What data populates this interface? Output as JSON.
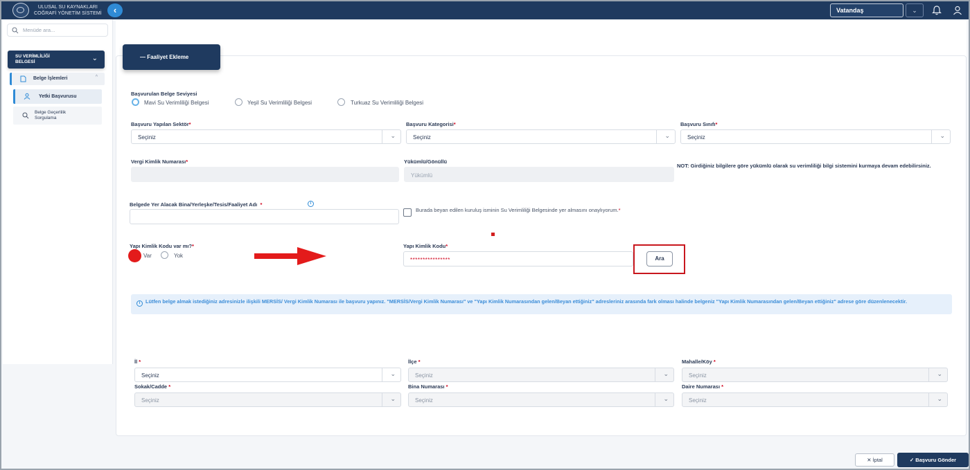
{
  "app": {
    "title_line1": "ULUSAL SU KAYNAKLARI",
    "title_line2": "COĞRAFİ YÖNETİM SİSTEMİ",
    "role": "Vatandaş"
  },
  "sidebar": {
    "search_placeholder": "Menüde ara...",
    "section": "SU VERİMLİLİĞİ BELGESİ",
    "group": "Belge İşlemleri",
    "items": [
      {
        "label": "Yetki Başvurusu"
      },
      {
        "label": "Belge Geçerlilik Sorgulama"
      }
    ]
  },
  "tab": {
    "label": "— Faaliyet Ekleme"
  },
  "form": {
    "seviye": {
      "label": "Başvurulan Belge Seviyesi",
      "options": [
        "Mavi Su Verimliliği Belgesi",
        "Yeşil Su Verimliliği Belgesi",
        "Turkuaz Su Verimliliği Belgesi"
      ],
      "selected": "Mavi Su Verimliliği Belgesi"
    },
    "sektor": {
      "label": "Başvuru Yapılan Sektör",
      "value": "Seçiniz"
    },
    "kategori": {
      "label": "Başvuru Kategorisi",
      "value": "Seçiniz"
    },
    "sinif": {
      "label": "Başvuru Sınıfı",
      "value": "Seçiniz"
    },
    "vkn": {
      "label": "Vergi Kimlik Numarası",
      "value": ""
    },
    "yukumlu": {
      "label": "Yükümlü/Gönüllü",
      "value": "Yükümlü"
    },
    "note": "NOT: Girdiğiniz bilgilere göre yükümlü olarak su verimliliği bilgi sistemini kurmaya devam edebilirsiniz.",
    "bina_adi": {
      "label": "Belgede Yer Alacak Bina/Yerleşke/Tesis/Faaliyet Adı",
      "value": ""
    },
    "onay_text": "Burada beyan edilen kuruluş isminin Su Verimliliği Belgesinde yer almasını onaylıyorum.",
    "yapi_var_mi": {
      "label": "Yapı Kimlik Kodu var mı?",
      "options": [
        "Var",
        "Yok"
      ],
      "selected": "Var"
    },
    "yapi_kod": {
      "label": "Yapı Kimlik Kodu",
      "value": "****************"
    },
    "ara_label": "Ara",
    "info": "Lütfen belge almak istediğiniz adresinizle ilişkili MERSİS/ Vergi Kimlik Numarası ile başvuru yapınız. \"MERSİS/Vergi Kimlik Numarası\" ve \"Yapı Kimlik Numarasından gelen/Beyan ettiğiniz\" adresleriniz arasında fark olması halinde belgeniz \"Yapı Kimlik Numarasından gelen/Beyan ettiğiniz\" adrese göre düzenlenecektir.",
    "address": {
      "il": {
        "label": "İl",
        "value": "Seçiniz"
      },
      "ilce": {
        "label": "İlçe",
        "value": "Seçiniz"
      },
      "mahalle": {
        "label": "Mahalle/Köy",
        "value": "Seçiniz"
      },
      "sokak": {
        "label": "Sokak/Cadde",
        "value": "Seçiniz"
      },
      "bina_no": {
        "label": "Bina Numarası",
        "value": "Seçiniz"
      },
      "daire_no": {
        "label": "Daire Numarası",
        "value": "Seçiniz"
      }
    }
  },
  "footer": {
    "cancel": "İptal",
    "submit": "Başvuru Gönder"
  },
  "colors": {
    "primary": "#1f3a5f",
    "accent": "#2f8bd6",
    "highlight": "#c8161d"
  }
}
